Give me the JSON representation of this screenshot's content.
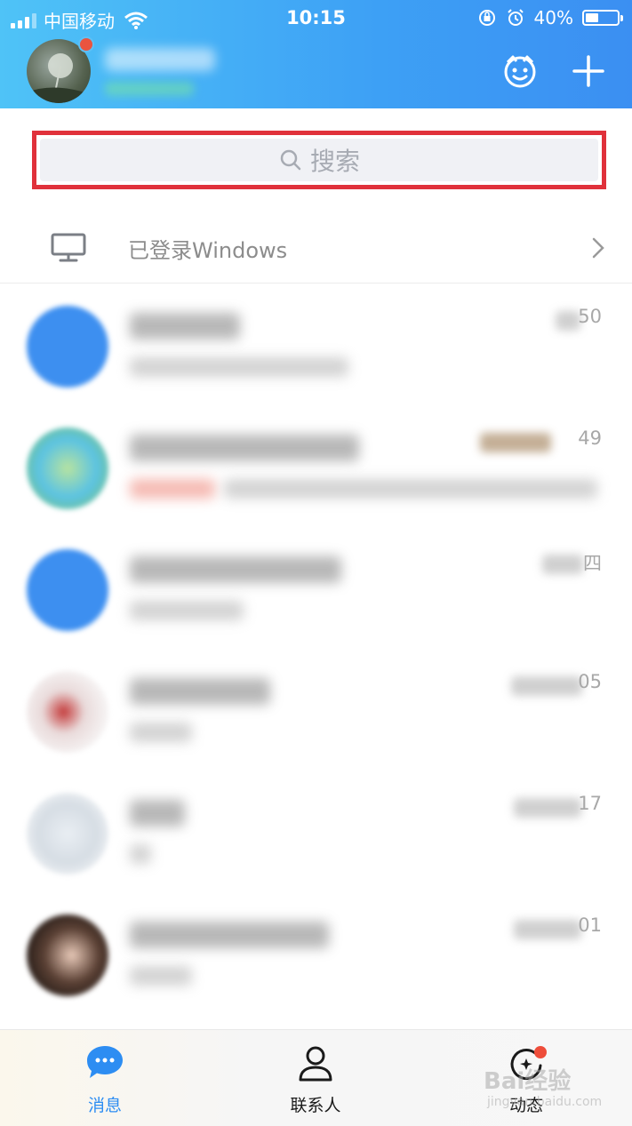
{
  "status_bar": {
    "carrier": "中国移动",
    "time": "10:15",
    "battery": "40%",
    "battery_level": 0.4
  },
  "header": {
    "profile_name": "",
    "online_status": "",
    "icons": [
      "smiley-face-icon",
      "plus-icon"
    ]
  },
  "search": {
    "placeholder": "搜索",
    "highlight_color": "#e0313b"
  },
  "login_banner": {
    "label": "已登录Windows",
    "icon": "monitor-icon"
  },
  "chats": [
    {
      "time": "50"
    },
    {
      "time": "49"
    },
    {
      "time": "四"
    },
    {
      "time": "05"
    },
    {
      "time": "17"
    },
    {
      "time": "01"
    }
  ],
  "tabbar": {
    "tabs": [
      {
        "label": "消息",
        "active": true
      },
      {
        "label": "联系人",
        "active": false
      },
      {
        "label": "动态",
        "active": false
      }
    ]
  },
  "watermark": {
    "text": "Bai经验",
    "sub": "jingyan.baidu.com"
  },
  "colors": {
    "accent": "#2d8df2",
    "header_gradient_start": "#4fc3f7",
    "header_gradient_end": "#3b8ff2",
    "badge": "#e9543f"
  }
}
